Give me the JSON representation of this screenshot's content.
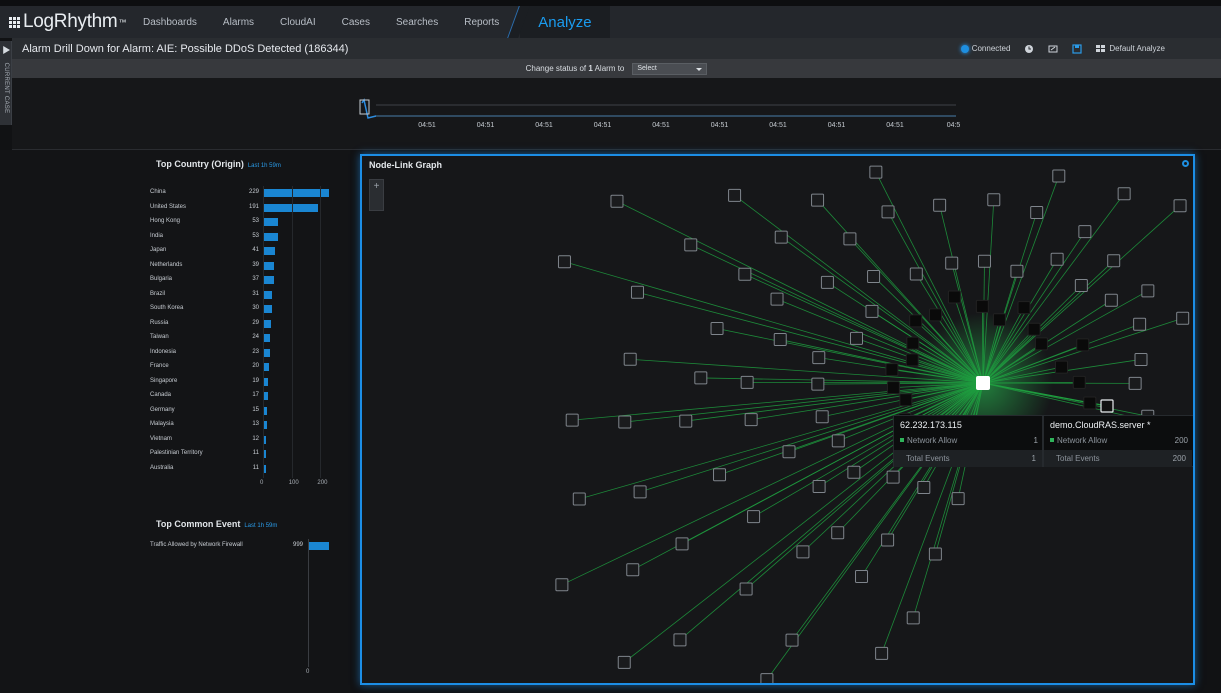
{
  "app": {
    "logo": "LogRhythm",
    "logo_tm": "™",
    "nav": [
      "Dashboards",
      "Alarms",
      "CloudAI",
      "Cases",
      "Searches",
      "Reports"
    ],
    "active_tab": "Analyze"
  },
  "titlebar": {
    "title": "Alarm Drill Down for Alarm: AIE: Possible DDoS Detected (186344)",
    "connection": "Connected",
    "layout_label": "Default Analyze"
  },
  "sidetab": {
    "label": "CURRENT CASE"
  },
  "status": {
    "prefix": "Change status of",
    "count": "1",
    "suffix": "Alarm to",
    "select_value": "Select"
  },
  "timeline": {
    "ticks": [
      "04:51",
      "04:51",
      "04:51",
      "04:51",
      "04:51",
      "04:51",
      "04:51",
      "04:51",
      "04:51",
      "04:5"
    ]
  },
  "top_country": {
    "title": "Top Country (Origin)",
    "range": "Last 1h 59m",
    "chart_data": {
      "type": "bar",
      "categories": [
        "China",
        "United States",
        "Hong Kong",
        "India",
        "Japan",
        "Netherlands",
        "Bulgaria",
        "Brazil",
        "South Korea",
        "Russia",
        "Taiwan",
        "Indonesia",
        "France",
        "Singapore",
        "Canada",
        "Germany",
        "Malaysia",
        "Vietnam",
        "Palestinian Territory",
        "Australia"
      ],
      "values": [
        229,
        191,
        53,
        53,
        41,
        39,
        37,
        31,
        30,
        29,
        24,
        23,
        20,
        19,
        17,
        15,
        13,
        12,
        11,
        11
      ],
      "xticks": [
        "0",
        "100",
        "200"
      ],
      "xlim": [
        0,
        230
      ]
    }
  },
  "top_event": {
    "title": "Top Common Event",
    "range": "Last 1h 59m",
    "chart_data": {
      "type": "bar",
      "categories": [
        "Traffic Allowed by Network Firewall"
      ],
      "values": [
        999
      ],
      "xticks": [
        "0"
      ],
      "xlim": [
        0,
        999
      ]
    }
  },
  "graph": {
    "title": "Node-Link Graph",
    "zoom_label": "+",
    "colors": {
      "link": "#1f9e3f",
      "border": "#1c8ee6"
    }
  },
  "tooltips": [
    {
      "host": "62.232.173.115",
      "rows": [
        {
          "label": "Network Allow",
          "value": "1"
        },
        {
          "label": "Total Events",
          "value": "1"
        }
      ]
    },
    {
      "host": "demo.CloudRAS.server *",
      "rows": [
        {
          "label": "Network Allow",
          "value": "200"
        },
        {
          "label": "Total Events",
          "value": "200"
        }
      ]
    }
  ]
}
